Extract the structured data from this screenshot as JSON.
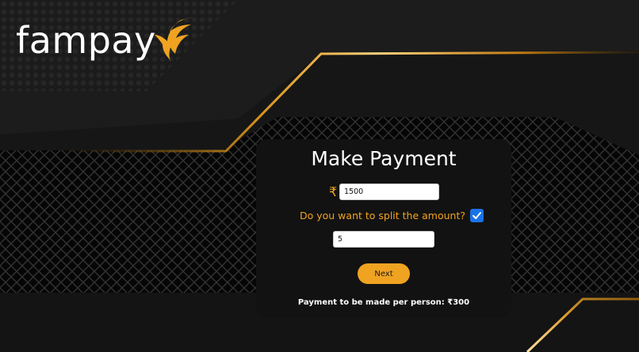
{
  "brand": {
    "name": "fampay",
    "accent": "#f0a321",
    "icon": "fampay-wing-logo-icon"
  },
  "form": {
    "title": "Make Payment",
    "currency_symbol": "₹",
    "amount_value": "1500",
    "split_question": "Do you want to split the amount?",
    "split_checked": true,
    "people_value": "5",
    "next_label": "Next",
    "result_text": "Payment to be made per person: ₹300"
  },
  "colors": {
    "background": "#161616",
    "card": "#121212",
    "checkbox": "#1a73e8"
  }
}
